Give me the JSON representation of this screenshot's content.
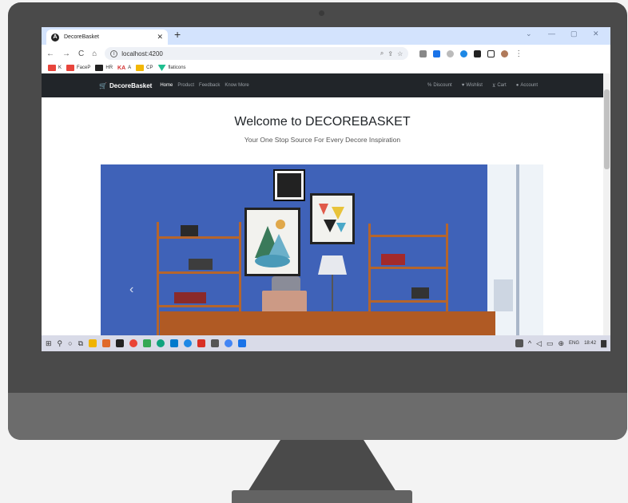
{
  "browser": {
    "tab_title": "DecoreBasket",
    "url": "localhost:4200",
    "bookmarks": [
      {
        "label": "K",
        "color": "#e8453c"
      },
      {
        "label": "FaceP",
        "color": "#e8453c"
      },
      {
        "label": "HR",
        "color": "#222222"
      },
      {
        "label": "A",
        "color": "#d32f2f"
      },
      {
        "label": "CP",
        "color": "#f2b705"
      },
      {
        "label": "flaticons",
        "color": "#1fbf8f"
      }
    ]
  },
  "site": {
    "brand": "DecoreBasket",
    "nav": [
      "Home",
      "Product",
      "Feedback",
      "Know More"
    ],
    "nav_right": [
      "Discount",
      "Wishlist",
      "Cart",
      "Account"
    ],
    "hero_title": "Welcome to DECOREBASKET",
    "hero_subtitle": "Your One Stop Source For Every Decore Inspiration"
  },
  "taskbar": {
    "lang": "ENG",
    "time": "18:42"
  },
  "colors": {
    "navbar": "#212529",
    "wall": "#3f62b8",
    "shelf": "#b5652c"
  }
}
